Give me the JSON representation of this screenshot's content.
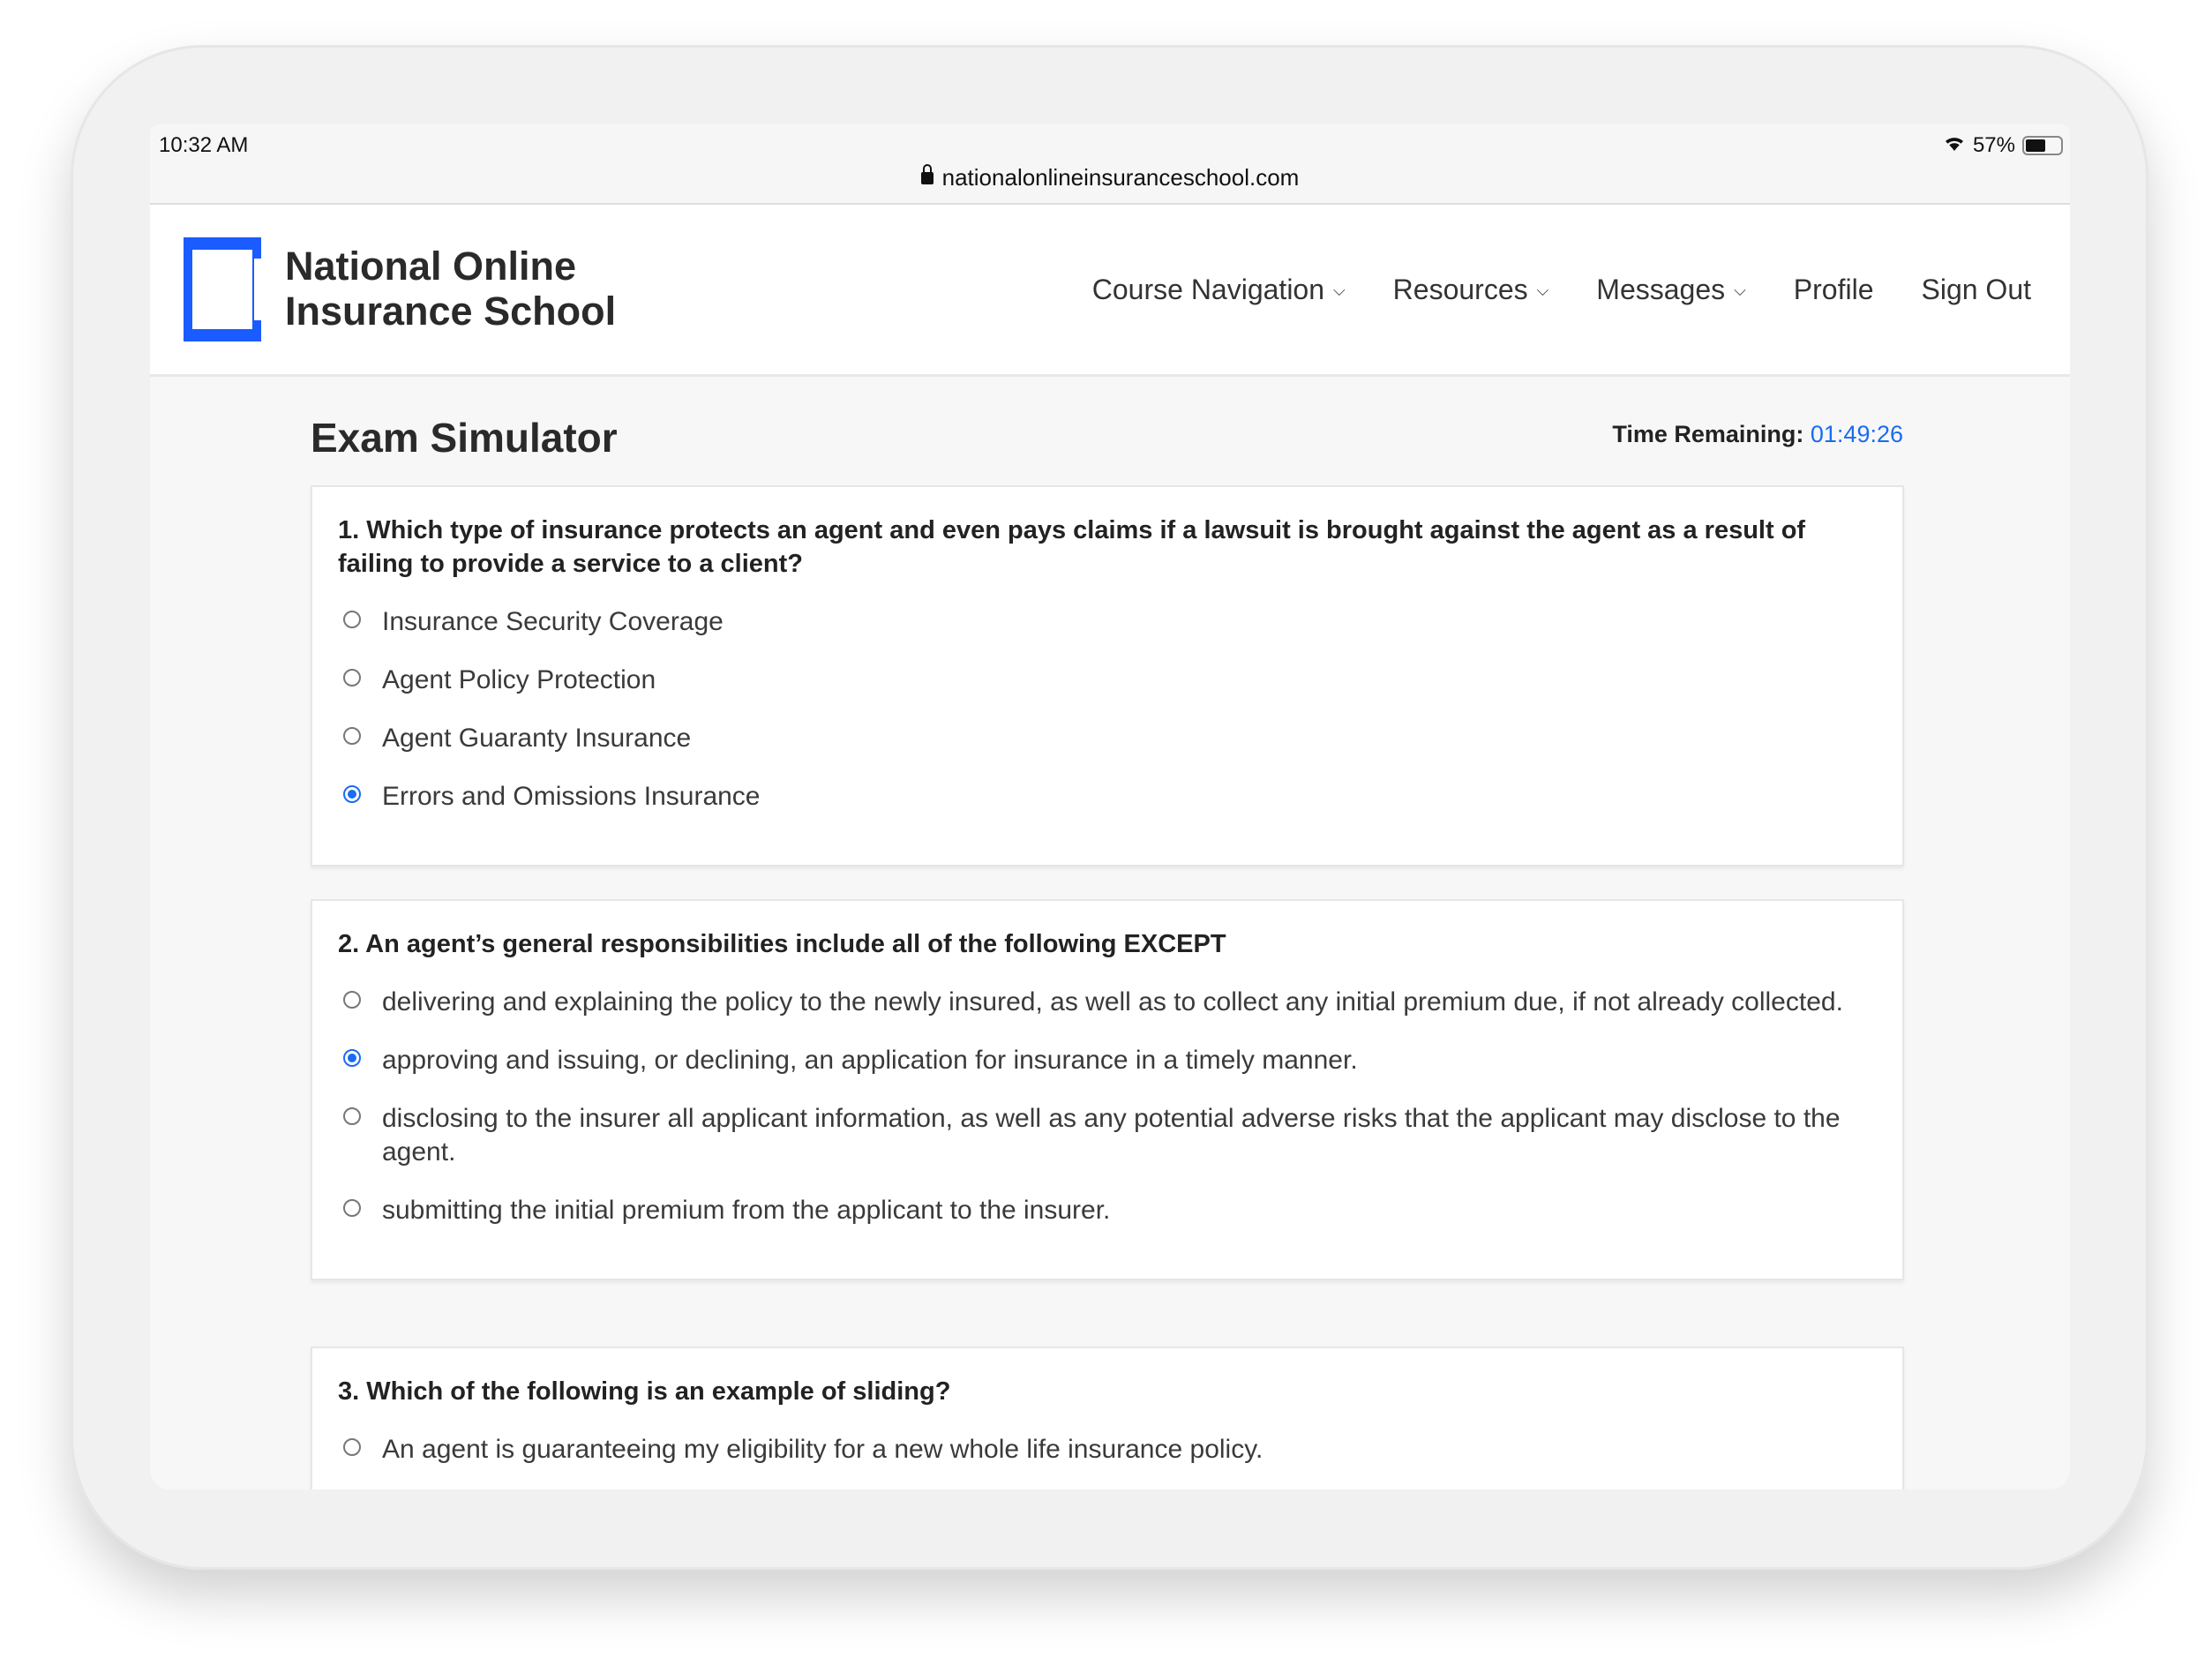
{
  "status_bar": {
    "time": "10:32 AM",
    "battery": "57%",
    "battery_level": 0.57,
    "icons": [
      "wifi-icon",
      "battery-icon"
    ]
  },
  "browser": {
    "url": "nationalonlineinsuranceschool.com",
    "icon": "lock-icon"
  },
  "brand": {
    "line1": "National Online",
    "line2": "Insurance School",
    "color": "#1a5cff"
  },
  "nav": {
    "items": [
      {
        "label": "Course Navigation",
        "dropdown": true
      },
      {
        "label": "Resources",
        "dropdown": true
      },
      {
        "label": "Messages",
        "dropdown": true
      },
      {
        "label": "Profile",
        "dropdown": false
      },
      {
        "label": "Sign Out",
        "dropdown": false
      }
    ],
    "chevron": "⌄"
  },
  "page": {
    "title": "Exam Simulator",
    "timer_label": "Time Remaining:",
    "timer_value": "01:49:26",
    "accent": "#1a6cf0"
  },
  "questions": [
    {
      "text": "1. Which type of insurance protects an agent and even pays claims if a lawsuit is brought against the agent as a result of failing to provide a service to a client?",
      "options": [
        "Insurance Security Coverage",
        "Agent Policy Protection",
        "Agent Guaranty Insurance",
        "Errors and Omissions Insurance"
      ],
      "selected": 3
    },
    {
      "text": "2. An agent’s general responsibilities include all of the following EXCEPT",
      "options": [
        "delivering and explaining the policy to the newly insured, as well as to collect any initial premium due, if not already collected.",
        "approving and issuing, or declining, an application for insurance in a timely manner.",
        "disclosing to the insurer all applicant information, as well as any potential adverse risks that the applicant may disclose to the agent.",
        "submitting the initial premium from the applicant to the insurer."
      ],
      "selected": 1
    },
    {
      "text": "3. Which of the following is an example of sliding?",
      "options": [
        "An agent is guaranteeing my eligibility for a new whole life insurance policy."
      ],
      "selected": null
    }
  ]
}
